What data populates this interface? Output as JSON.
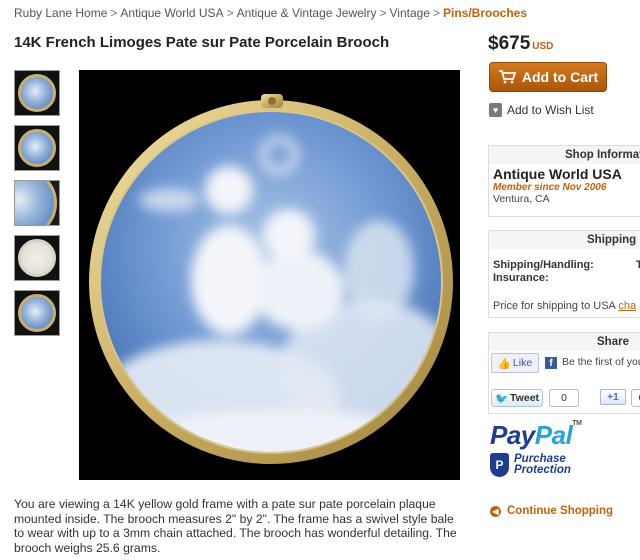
{
  "breadcrumb": {
    "items": [
      "Ruby Lane Home",
      "Antique World USA",
      "Antique & Vintage Jewelry",
      "Vintage"
    ],
    "current": "Pins/Brooches",
    "separator": ">"
  },
  "product": {
    "title": "14K French Limoges Pate sur Pate Porcelain Brooch",
    "description": "You are viewing a 14K yellow gold frame with a pate sur pate porcelain plaque mounted inside. The brooch measures 2\" by 2\". The frame has a swivel style bale to wear with up to a 3mm chain attached. The brooch has wonderful detailing. The brooch weighs 25.6 grams.",
    "thumbnail_count": 5
  },
  "purchase": {
    "price": "$675",
    "currency": "USD",
    "add_to_cart_label": "Add to Cart",
    "wishlist_label": "Add to Wish List",
    "accent_color": "#c0620b"
  },
  "shop_info": {
    "header": "Shop Informat",
    "name": "Antique World USA",
    "member_since": "Member since Nov 2006",
    "location": "Ventura, CA"
  },
  "shipping": {
    "header": "Shipping",
    "handling_label": "Shipping/Handling:",
    "handling_value": "T",
    "insurance_label": "Insurance:",
    "note": "Price for shipping to USA",
    "note_link": "cha"
  },
  "share": {
    "header": "Share",
    "like_label": "Like",
    "fb_text": "Be the first of you",
    "tweet_label": "Tweet",
    "tweet_count": "0",
    "gplus_label": "+1",
    "gplus_count": "0"
  },
  "paypal": {
    "pay": "Pay",
    "pal": "Pal",
    "tm": "TM",
    "protection_line1": "Purchase",
    "protection_line2": "Protection"
  },
  "continue_label": "Continue Shopping"
}
